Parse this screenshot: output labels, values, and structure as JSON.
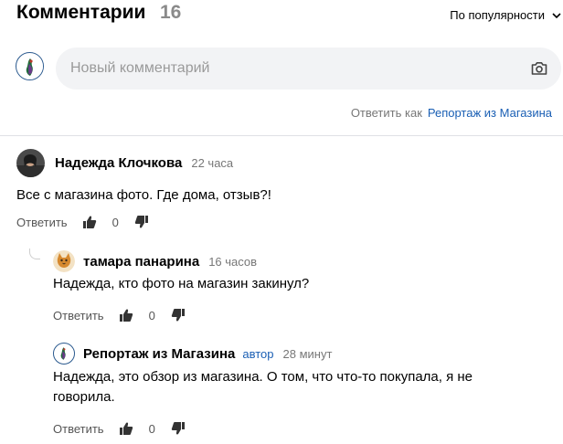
{
  "header": {
    "title": "Комментарии",
    "count": "16",
    "sort_label": "По популярности"
  },
  "composer": {
    "placeholder": "Новый комментарий"
  },
  "reply_as": {
    "label": "Ответить как",
    "account": "Репортаж из Магазина"
  },
  "comments": [
    {
      "name": "Надежда Клочкова",
      "time": "22 часа",
      "text": "Все с магазина фото. Где дома, отзыв?!",
      "reply_label": "Ответить",
      "score": "0"
    },
    {
      "name": "тамара панарина",
      "time": "16 часов",
      "text": "Надежда, кто фото на магазин закинул?",
      "reply_label": "Ответить",
      "score": "0"
    },
    {
      "name": "Репортаж из Магазина",
      "author_badge": "автор",
      "time": "28 минут",
      "text_line1": "Надежда, это обзор из магазина. О том, что что-то покупала, я не",
      "text_line2": "говорила.",
      "reply_label": "Ответить",
      "score": "0"
    }
  ],
  "colors": {
    "link": "#1a5fb4",
    "muted": "#777777",
    "input_bg": "#f2f3f5"
  },
  "icons": [
    "chevron-down-icon",
    "camera-icon",
    "thumbs-up-icon",
    "thumbs-down-icon"
  ]
}
